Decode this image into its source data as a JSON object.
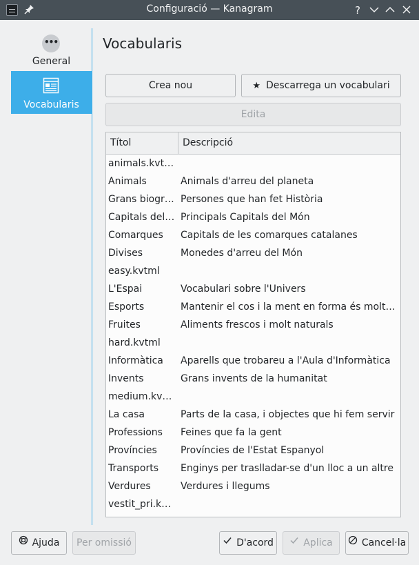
{
  "window": {
    "title": "Configuració — Kanagram",
    "controls": [
      "help-icon",
      "minimize-icon",
      "maximize-icon",
      "close-icon"
    ]
  },
  "sidebar": {
    "items": [
      {
        "label": "General",
        "icon": "more-dots-icon",
        "selected": false
      },
      {
        "label": "Vocabularis",
        "icon": "vocabulary-list-icon",
        "selected": true
      }
    ]
  },
  "main": {
    "title": "Vocabularis",
    "buttons": {
      "create": "Crea nou",
      "download": "Descarrega un vocabulari nou",
      "edit": "Edita"
    },
    "table": {
      "columns": [
        "Títol",
        "Descripció"
      ],
      "rows": [
        {
          "title": "animals.kvtml",
          "desc": ""
        },
        {
          "title": "Animals",
          "desc": "Animals d'arreu del planeta"
        },
        {
          "title": "Grans biogra...",
          "desc": "Persones que han fet Història"
        },
        {
          "title": "Capitals del ...",
          "desc": "Principals Capitals del Món"
        },
        {
          "title": "Comarques",
          "desc": "Capitals de les comarques catalanes"
        },
        {
          "title": "Divises",
          "desc": "Monedes d'arreu del Món"
        },
        {
          "title": "easy.kvtml",
          "desc": ""
        },
        {
          "title": "L'Espai",
          "desc": "Vocabulari sobre l'Univers"
        },
        {
          "title": "Esports",
          "desc": "Mantenir el cos i la ment en forma és molt im..."
        },
        {
          "title": "Fruites",
          "desc": "Aliments frescos i molt naturals"
        },
        {
          "title": "hard.kvtml",
          "desc": ""
        },
        {
          "title": "Informàtica",
          "desc": "Aparells que trobareu a l'Aula d'Informàtica"
        },
        {
          "title": "Invents",
          "desc": "Grans invents de la humanitat"
        },
        {
          "title": "medium.kvtml",
          "desc": ""
        },
        {
          "title": "La casa",
          "desc": "Parts de la casa, i objectes que hi fem servir"
        },
        {
          "title": "Professions",
          "desc": "Feines que fa la gent"
        },
        {
          "title": "Províncies",
          "desc": "Províncies de l'Estat Espanyol"
        },
        {
          "title": "Transports",
          "desc": "Enginys per traslladar-se d'un lloc a un altre"
        },
        {
          "title": "Verdures",
          "desc": "Verdures i llegums"
        },
        {
          "title": "vestit_pri.kvt...",
          "desc": ""
        }
      ]
    }
  },
  "footer": {
    "help": "Ajuda",
    "defaults": "Per omissió",
    "ok": "D'acord",
    "apply": "Aplica",
    "cancel": "Cancel·la"
  },
  "colors": {
    "accent": "#3daee9",
    "titlebar": "#475057",
    "window_bg": "#eff0f1"
  }
}
